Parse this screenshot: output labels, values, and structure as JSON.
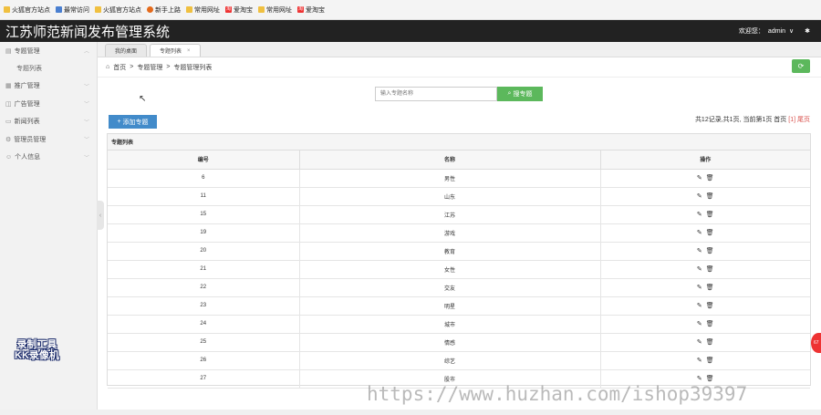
{
  "bookmarks": [
    {
      "label": "火狐官方站点",
      "icon": "folder-icon"
    },
    {
      "label": "最常访问",
      "icon": "page-icon"
    },
    {
      "label": "火狐官方站点",
      "icon": "folder-icon"
    },
    {
      "label": "新手上路",
      "icon": "firefox-icon"
    },
    {
      "label": "常用网址",
      "icon": "folder-icon"
    },
    {
      "label": "爱淘宝",
      "icon": "taobao-icon"
    },
    {
      "label": "常用网址",
      "icon": "folder-icon"
    },
    {
      "label": "爱淘宝",
      "icon": "taobao-icon"
    }
  ],
  "app": {
    "title": "江苏师范新闻发布管理系统",
    "welcome": "欢迎您：",
    "username": "admin",
    "dropdown": "∨"
  },
  "sidebar": {
    "items": [
      {
        "label": "专题管理",
        "open": true,
        "children": [
          "专题列表"
        ]
      },
      {
        "label": "推广管理"
      },
      {
        "label": "广告管理"
      },
      {
        "label": "新闻列表"
      },
      {
        "label": "管理员管理"
      },
      {
        "label": "个人信息"
      }
    ],
    "collapse": "‹"
  },
  "tabs": [
    {
      "label": "我的桌面"
    },
    {
      "label": "专题列表",
      "close": "×"
    }
  ],
  "breadcrumb": {
    "home": "首页",
    "sep": ">",
    "level1": "专题管理",
    "level2": "专题管理列表"
  },
  "toolbar": {
    "refresh": "⟳",
    "search_placeholder": "输入专题名称",
    "search_button": "搜专题",
    "add_button": "添加专题"
  },
  "pager": {
    "summary": "共12记录,共1页, 当前第1页 首页",
    "current": "[1]",
    "last": "尾页"
  },
  "panel": {
    "title": "专题列表"
  },
  "table": {
    "columns": [
      "编号",
      "名称",
      "操作"
    ],
    "rows": [
      {
        "id": "6",
        "name": "男性"
      },
      {
        "id": "11",
        "name": "山东"
      },
      {
        "id": "15",
        "name": "江苏"
      },
      {
        "id": "19",
        "name": "游戏"
      },
      {
        "id": "20",
        "name": "教育"
      },
      {
        "id": "21",
        "name": "女性"
      },
      {
        "id": "22",
        "name": "交友"
      },
      {
        "id": "23",
        "name": "明星"
      },
      {
        "id": "24",
        "name": "城市"
      },
      {
        "id": "25",
        "name": "情感"
      },
      {
        "id": "26",
        "name": "综艺"
      },
      {
        "id": "27",
        "name": "股市"
      }
    ]
  },
  "overlays": {
    "kk_line1": "录制工具",
    "kk_line2": "KK录像机",
    "watermark": "https://www.huzhan.com/ishop39397",
    "badge": "67"
  }
}
